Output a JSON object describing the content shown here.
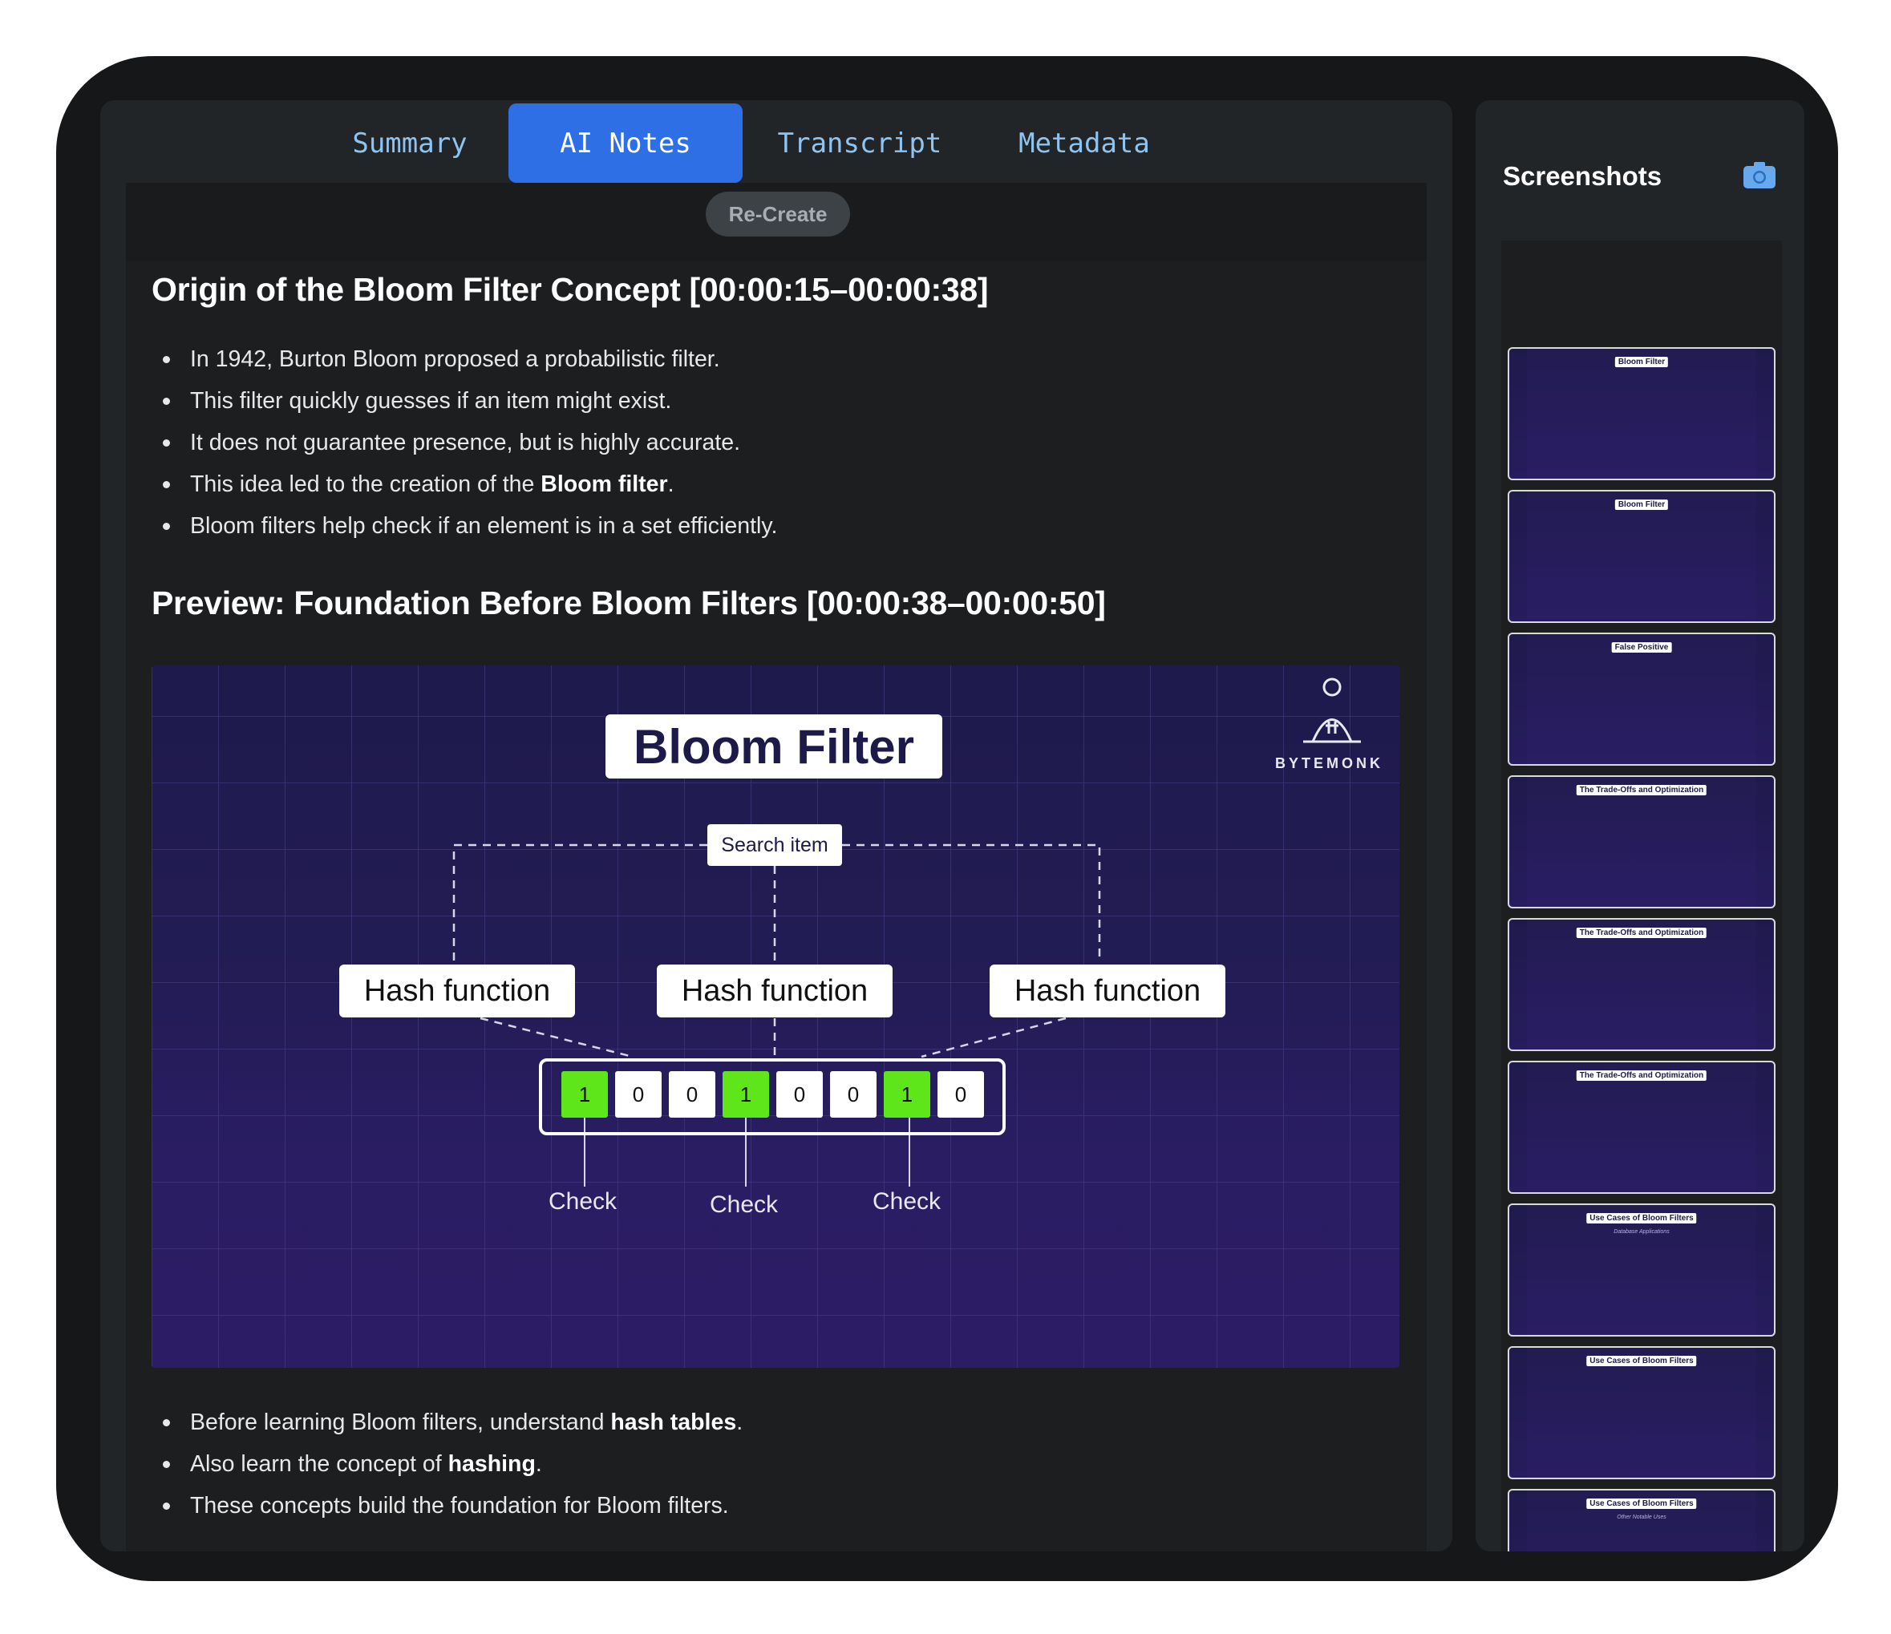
{
  "tabs": [
    {
      "label": "Summary",
      "active": false
    },
    {
      "label": "AI Notes",
      "active": true
    },
    {
      "label": "Transcript",
      "active": false
    },
    {
      "label": "Metadata",
      "active": false
    }
  ],
  "recreate_label": "Re-Create",
  "sections": [
    {
      "heading": "Origin of the Bloom Filter Concept [00:00:15–00:00:38]",
      "bullets": [
        {
          "pre": "In 1942, Burton Bloom proposed a probabilistic filter.",
          "bold": "",
          "post": ""
        },
        {
          "pre": "This filter quickly guesses if an item might exist.",
          "bold": "",
          "post": ""
        },
        {
          "pre": "It does not guarantee presence, but is highly accurate.",
          "bold": "",
          "post": ""
        },
        {
          "pre": "This idea led to the creation of the ",
          "bold": "Bloom filter",
          "post": "."
        },
        {
          "pre": "Bloom filters help check if an element is in a set efficiently.",
          "bold": "",
          "post": ""
        }
      ]
    },
    {
      "heading": "Preview: Foundation Before Bloom Filters [00:00:38–00:00:50]",
      "bullets": [
        {
          "pre": "Before learning Bloom filters, understand ",
          "bold": "hash tables",
          "post": "."
        },
        {
          "pre": "Also learn the concept of ",
          "bold": "hashing",
          "post": "."
        },
        {
          "pre": "These concepts build the foundation for Bloom filters.",
          "bold": "",
          "post": ""
        }
      ]
    }
  ],
  "slide": {
    "title": "Bloom Filter",
    "search_item": "Search item",
    "hash_label": "Hash function",
    "bits": [
      "1",
      "0",
      "0",
      "1",
      "0",
      "0",
      "1",
      "0"
    ],
    "check_label": "Check",
    "brand": "BYTEMONK",
    "accent_on": "#5ee61a"
  },
  "sidebar": {
    "title": "Screenshots",
    "camera_icon": "camera-icon",
    "thumbnails": [
      {
        "title": "Bloom Filter",
        "subtitle": ""
      },
      {
        "title": "Bloom Filter",
        "subtitle": ""
      },
      {
        "title": "False Positive",
        "subtitle": ""
      },
      {
        "title": "The Trade-Offs and Optimization",
        "subtitle": ""
      },
      {
        "title": "The Trade-Offs and Optimization",
        "subtitle": ""
      },
      {
        "title": "The Trade-Offs and Optimization",
        "subtitle": ""
      },
      {
        "title": "Use Cases of Bloom Filters",
        "subtitle": "Database Applications"
      },
      {
        "title": "Use Cases of Bloom Filters",
        "subtitle": ""
      },
      {
        "title": "Use Cases of Bloom Filters",
        "subtitle": "Other Notable Uses"
      }
    ]
  },
  "colors": {
    "accent_blue": "#2f6fe6",
    "tab_text": "#8fc4f0",
    "frame": "#151718",
    "panel": "#222528"
  }
}
